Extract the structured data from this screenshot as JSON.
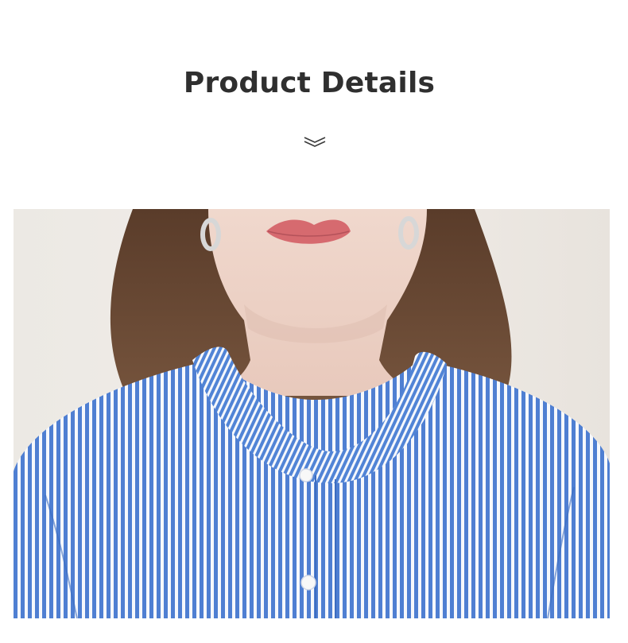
{
  "header": {
    "title": "Product Details",
    "scroll_indicator_icon": "double-chevron-down-icon"
  },
  "photo": {
    "subject": "model-wearing-striped-shirt",
    "colors": {
      "stripe_blue": "#4f7fd2",
      "stripe_white": "#f6f8fc",
      "skin": "#ecd2c6",
      "hair": "#6b4a34",
      "lips": "#d66a6f",
      "background": "#efebe6"
    }
  }
}
